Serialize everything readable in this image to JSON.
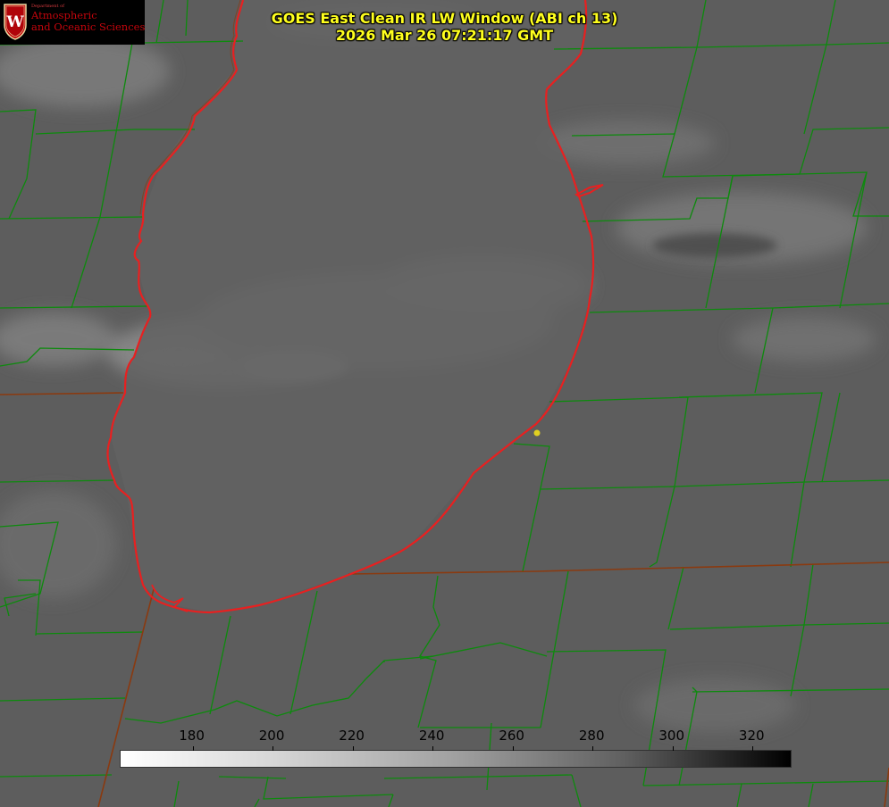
{
  "title": {
    "line1": "GOES East Clean IR LW Window (ABI ch 13)",
    "line2": "2026 Mar 26 07:21:17 GMT"
  },
  "logo": {
    "dept": "Department of",
    "line1": "Atmospheric",
    "line2": "and Oceanic Sciences",
    "seal_letter": "W"
  },
  "colorbar": {
    "min": 162,
    "max": 330,
    "ticks": [
      {
        "label": "180",
        "value": 180
      },
      {
        "label": "200",
        "value": 200
      },
      {
        "label": "220",
        "value": 220
      },
      {
        "label": "240",
        "value": 240
      },
      {
        "label": "260",
        "value": 260
      },
      {
        "label": "280",
        "value": 280
      },
      {
        "label": "300",
        "value": 300
      },
      {
        "label": "320",
        "value": 320
      }
    ]
  },
  "colors": {
    "title_text": "#ffff1e",
    "county_lines": "#0d8a0d",
    "state_lines": "#8a3a10",
    "lakeshore": "#e82020",
    "marker": "#e0d020",
    "logo_red": "#c5050c"
  }
}
